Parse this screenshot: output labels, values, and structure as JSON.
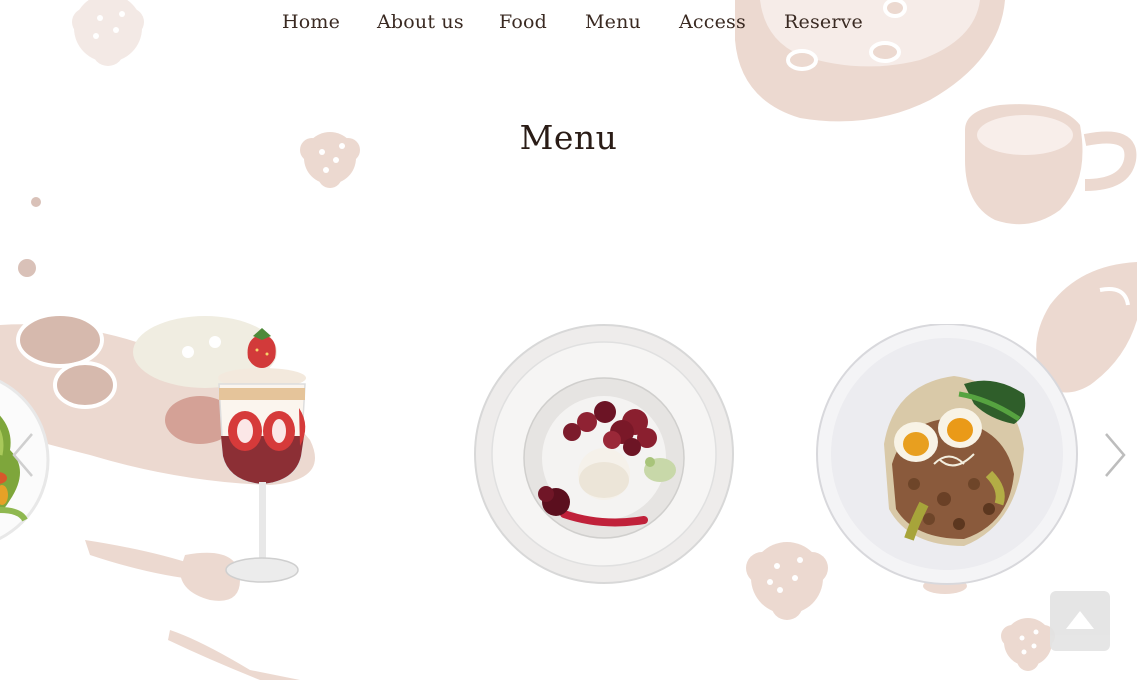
{
  "nav": {
    "items": [
      {
        "label": "Home"
      },
      {
        "label": "About us"
      },
      {
        "label": "Food"
      },
      {
        "label": "Menu"
      },
      {
        "label": "Access"
      },
      {
        "label": "Reserve"
      }
    ]
  },
  "main": {
    "title": "Menu"
  },
  "carousel": {
    "slides": [
      {
        "icon": "salad-photo"
      },
      {
        "icon": "strawberry-parfait-photo"
      },
      {
        "icon": "dessert-plate-photo"
      },
      {
        "icon": "minced-meat-rice-bowl-photo"
      }
    ],
    "prev_icon": "chevron-left-icon",
    "next_icon": "chevron-right-icon"
  },
  "back_to_top": {
    "icon": "triangle-up-icon"
  },
  "colors": {
    "deco": "#ecd9d0",
    "deco_light": "#f3ebe7",
    "text": "#3a2a22",
    "title": "#2a1c16",
    "back_to_top_bg": "#e3e3e3"
  }
}
